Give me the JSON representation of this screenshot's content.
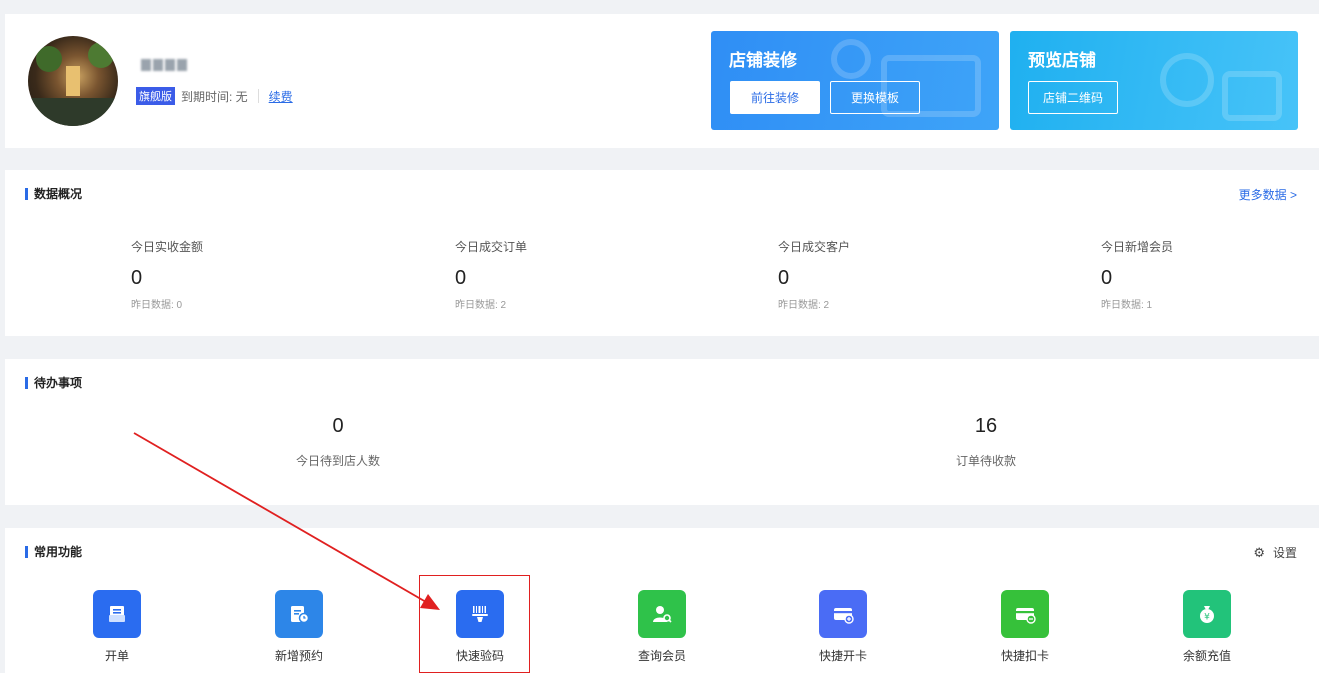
{
  "shop": {
    "edition_badge": "旗舰版",
    "expiry_label": "到期时间: 无",
    "renew_link": "续费"
  },
  "promos": {
    "decor": {
      "title": "店铺装修",
      "btn_go": "前往装修",
      "btn_template": "更换模板"
    },
    "preview": {
      "title": "预览店铺",
      "btn_qr": "店铺二维码"
    }
  },
  "data_overview": {
    "title": "数据概况",
    "more_link": "更多数据 >",
    "stats": [
      {
        "label": "今日实收金额",
        "value": "0",
        "yesterday": "昨日数据: 0"
      },
      {
        "label": "今日成交订单",
        "value": "0",
        "yesterday": "昨日数据: 2"
      },
      {
        "label": "今日成交客户",
        "value": "0",
        "yesterday": "昨日数据: 2"
      },
      {
        "label": "今日新增会员",
        "value": "0",
        "yesterday": "昨日数据: 1"
      }
    ]
  },
  "todo": {
    "title": "待办事项",
    "items": [
      {
        "value": "0",
        "label": "今日待到店人数"
      },
      {
        "value": "16",
        "label": "订单待收款"
      }
    ]
  },
  "functions": {
    "title": "常用功能",
    "settings_label": "设置",
    "items": [
      {
        "label": "开单",
        "icon": "order-icon",
        "color": "#2a6cf0"
      },
      {
        "label": "新增预约",
        "icon": "appointment-icon",
        "color": "#2d86e8"
      },
      {
        "label": "快速验码",
        "icon": "scan-code-icon",
        "color": "#2a6cf0"
      },
      {
        "label": "查询会员",
        "icon": "member-search-icon",
        "color": "#2fc24a"
      },
      {
        "label": "快捷开卡",
        "icon": "open-card-icon",
        "color": "#4a6cf5"
      },
      {
        "label": "快捷扣卡",
        "icon": "deduct-card-icon",
        "color": "#36c13a"
      },
      {
        "label": "余额充值",
        "icon": "recharge-icon",
        "color": "#22c37a"
      }
    ]
  }
}
